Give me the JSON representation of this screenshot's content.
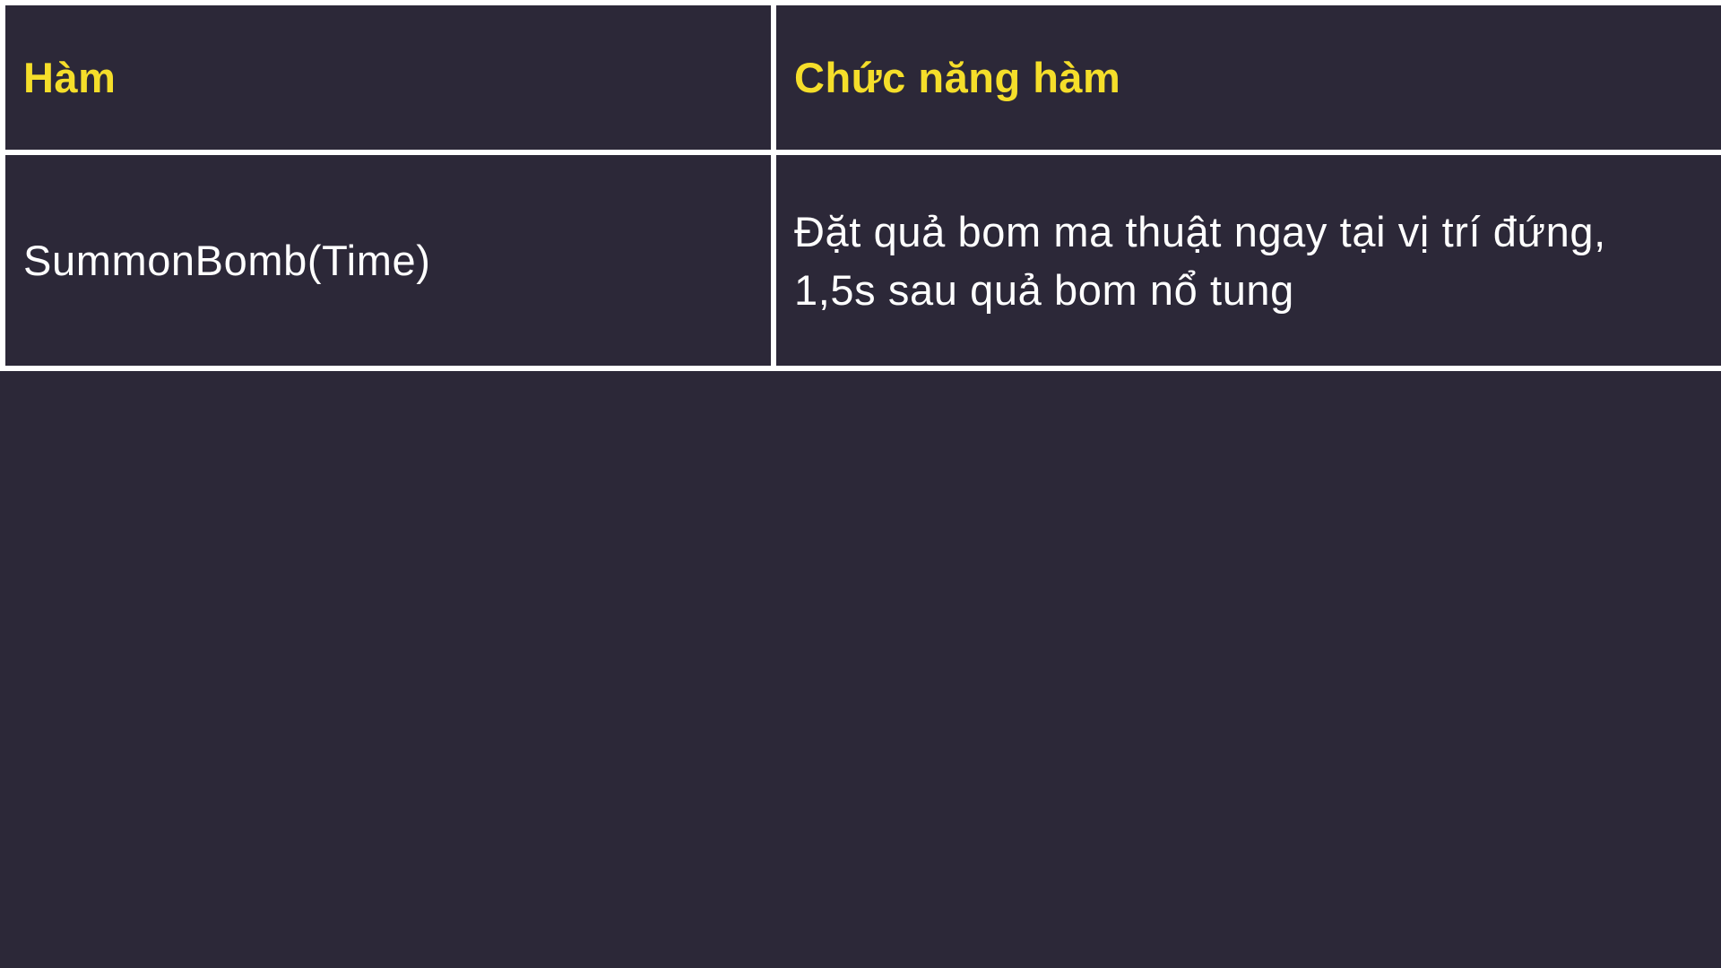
{
  "table": {
    "headers": [
      "Hàm",
      "Chức năng hàm"
    ],
    "rows": [
      {
        "function": "SummonBomb(Time)",
        "description_lines": [
          "Đặt quả bom ma thuật ngay tại vị trí đứng,",
          "1,5s sau quả bom nổ tung"
        ]
      }
    ]
  },
  "colors": {
    "background": "#2c2838",
    "header_text": "#f5de2a",
    "body_text": "#ffffff",
    "border": "#ffffff"
  }
}
